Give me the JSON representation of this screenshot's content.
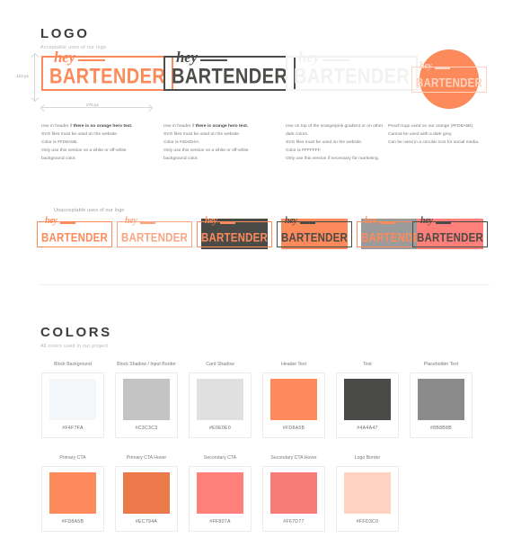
{
  "palette": {
    "orange": "#FD8A5B",
    "orange_hover": "#EC794A",
    "dark": "#4A4A47",
    "dark_logo": "#4D4D4A",
    "white": "#FFFFFF",
    "peach": "#FFD3C0",
    "grey": "#8B8B8B",
    "salmon": "#FF807A",
    "page_bg": "#FFFFFF"
  },
  "logo_section": {
    "title": "LOGO",
    "subtitle": "Acceptable uses of our logo",
    "unacceptable_label": "Unacceptable uses of our logo",
    "measurements": {
      "height": "123 px",
      "width": "276 px"
    },
    "wordmark": {
      "script": "hey",
      "main": "BARTENDER"
    },
    "variants": [
      {
        "name": "orange-logo",
        "logo_color": "#FD8A5B",
        "background": "#FFFFFF",
        "notes": [
          {
            "text": "Use in header if ",
            "bold": "there is no orange hero text."
          },
          {
            "text": "SVG files must be used on the website.",
            "bold": ""
          },
          {
            "text": "Color is #FD8A5B.",
            "bold": ""
          },
          {
            "text": "Only use this version on a white or off-white",
            "bold": ""
          },
          {
            "text": "background color.",
            "bold": ""
          }
        ]
      },
      {
        "name": "dark-logo",
        "logo_color": "#4D4D4A",
        "background": "#FFFFFF",
        "notes": [
          {
            "text": "Use in header if ",
            "bold": "there is orange hero text."
          },
          {
            "text": "SVG files must be used on the website.",
            "bold": ""
          },
          {
            "text": "Color is #4D4D4A.",
            "bold": ""
          },
          {
            "text": "Only use this version on a white or off-white",
            "bold": ""
          },
          {
            "text": "background color.",
            "bold": ""
          }
        ]
      },
      {
        "name": "white-logo",
        "logo_color": "#F2F2F2",
        "background": "#FFFFFF",
        "notes": [
          {
            "text": "Use on top of the orange/pink gradient or on other",
            "bold": ""
          },
          {
            "text": "dark colors.",
            "bold": ""
          },
          {
            "text": "SVG files must be used on the website.",
            "bold": ""
          },
          {
            "text": "Color is #FFFFFF.",
            "bold": ""
          },
          {
            "text": "Only use this version if necessary for marketing.",
            "bold": ""
          }
        ]
      },
      {
        "name": "circle-logo",
        "logo_color": "#FFD3C0",
        "background": "#FD8A5B",
        "notes": [
          {
            "text": "Peach logo used on our orange (#FD8A5B).",
            "bold": ""
          },
          {
            "text": "Cannot be used with a dark grey.",
            "bold": ""
          },
          {
            "text": "Can be used in a circular icon for social media.",
            "bold": ""
          }
        ]
      }
    ],
    "unacceptable": [
      {
        "name": "orange-on-white-small",
        "logo_color": "#FD8A5B",
        "background": "transparent"
      },
      {
        "name": "light-orange-outline",
        "logo_color": "#FBA683",
        "background": "transparent"
      },
      {
        "name": "orange-on-dark",
        "logo_color": "#FD8A5B",
        "background": "#4A4A47"
      },
      {
        "name": "dark-on-orange",
        "logo_color": "#4A4A47",
        "background": "#FD8A5B"
      },
      {
        "name": "orange-on-grey",
        "logo_color": "#FD8A5B",
        "background": "#9B9B9B"
      },
      {
        "name": "dark-on-salmon",
        "logo_color": "#4A4A47",
        "background": "#FF807A"
      }
    ]
  },
  "colors_section": {
    "title": "COLORS",
    "subtitle": "All colors used in our project",
    "swatches": [
      {
        "name": "Block Background",
        "hex": "#F4F7FA"
      },
      {
        "name": "Block Shadow / Input Border",
        "hex": "#C3C3C3"
      },
      {
        "name": "Card Shadow",
        "hex": "#E0E0E0"
      },
      {
        "name": "Header Text",
        "hex": "#FD8A5B"
      },
      {
        "name": "Text",
        "hex": "#4A4A47"
      },
      {
        "name": "Placeholder Text",
        "hex": "#8B8B8B"
      },
      {
        "name": "Primary CTA",
        "hex": "#FD8A5B"
      },
      {
        "name": "Primary CTA Hover",
        "hex": "#EC794A"
      },
      {
        "name": "Secondary CTA",
        "hex": "#FF807A"
      },
      {
        "name": "Secondary CTA Hover",
        "hex": "#F67D77"
      },
      {
        "name": "Logo Border",
        "hex": "#FFD3C0"
      }
    ]
  }
}
